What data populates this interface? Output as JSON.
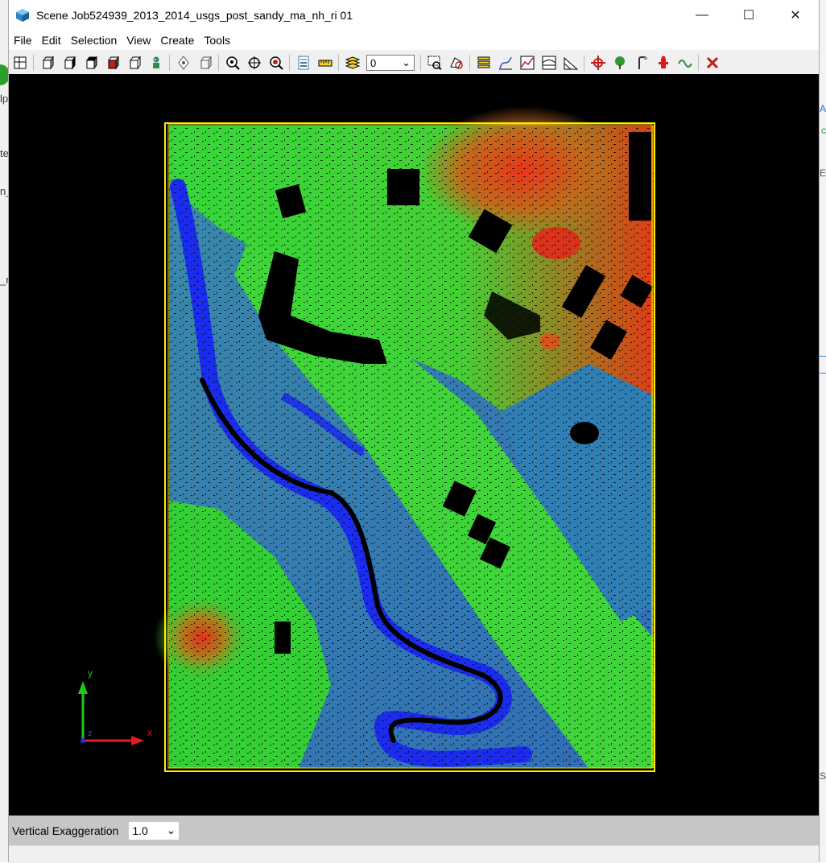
{
  "window": {
    "title": "Scene Job524939_2013_2014_usgs_post_sandy_ma_nh_ri 01",
    "controls": {
      "minimize": "—",
      "maximize": "☐",
      "close": "✕"
    }
  },
  "menu": [
    "File",
    "Edit",
    "Selection",
    "View",
    "Create",
    "Tools"
  ],
  "toolbar": {
    "icons": [
      "layout-icon",
      "cube-front-icon",
      "cube-side-icon",
      "cube-top-icon",
      "cube-red-icon",
      "cube-iso-icon",
      "robot-icon",
      "rotate-icon",
      "cube-outline-icon",
      "zoom-icon",
      "pan-icon",
      "zoom-target-icon",
      "document-icon",
      "ruler-icon",
      "layers-icon",
      "select-rect-icon",
      "select-poly-icon",
      "stack-icon",
      "profile-icon",
      "line-chart-icon",
      "cross-section-icon",
      "slope-icon",
      "target-icon",
      "tree-icon",
      "pole-icon",
      "hydrant-icon",
      "wave-icon",
      "close-red-icon"
    ],
    "layer_value": "0"
  },
  "scene": {
    "axes": {
      "x_label": "x",
      "y_label": "y",
      "z_label": "z"
    },
    "colors": {
      "low": "#1f2ff0",
      "mid": "#22c43a",
      "high": "#e33a16",
      "frame": "#ffee00"
    }
  },
  "status": {
    "vertical_exaggeration_label": "Vertical Exaggeration",
    "vertical_exaggeration_value": "1.0"
  },
  "background": {
    "left_texts": [
      "lp",
      "te",
      "n_",
      "_m"
    ],
    "right_texts": [
      "A",
      "c",
      "E",
      "S"
    ]
  }
}
